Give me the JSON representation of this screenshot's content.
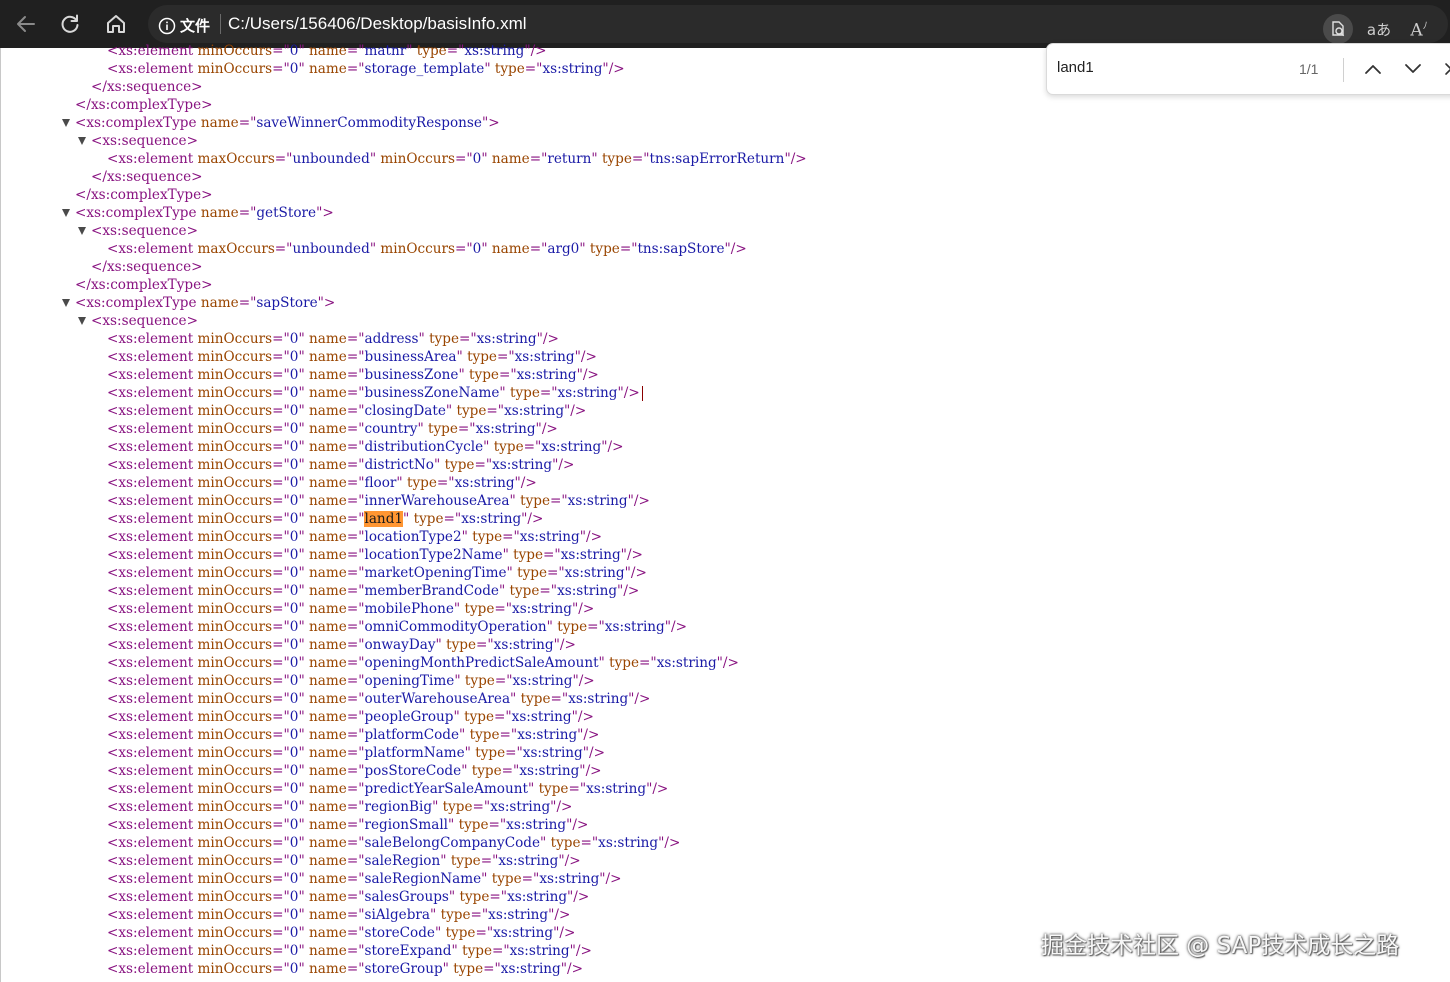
{
  "browser": {
    "info_label": "文件",
    "url": "C:/Users/156406/Desktop/basisInfo.xml"
  },
  "find": {
    "query": "land1",
    "count": "1/1"
  },
  "watermark": "掘金技术社区 @ SAP技术成长之路",
  "xml_lines": [
    {
      "indent": 6,
      "tw": false,
      "kind": "elem",
      "attrs": [
        [
          "minOccurs",
          "0"
        ],
        [
          "name",
          "matnr"
        ],
        [
          "type",
          "xs:string"
        ]
      ]
    },
    {
      "indent": 6,
      "tw": false,
      "kind": "elem",
      "attrs": [
        [
          "minOccurs",
          "0"
        ],
        [
          "name",
          "storage_template"
        ],
        [
          "type",
          "xs:string"
        ]
      ]
    },
    {
      "indent": 4,
      "tw": false,
      "kind": "close",
      "tag": "xs:sequence"
    },
    {
      "indent": 2,
      "tw": false,
      "kind": "close",
      "tag": "xs:complexType"
    },
    {
      "indent": 2,
      "tw": true,
      "kind": "open",
      "tag": "xs:complexType",
      "attrs": [
        [
          "name",
          "saveWinnerCommodityResponse"
        ]
      ]
    },
    {
      "indent": 4,
      "tw": true,
      "kind": "open",
      "tag": "xs:sequence",
      "attrs": []
    },
    {
      "indent": 6,
      "tw": false,
      "kind": "elem",
      "attrs": [
        [
          "maxOccurs",
          "unbounded"
        ],
        [
          "minOccurs",
          "0"
        ],
        [
          "name",
          "return"
        ],
        [
          "type",
          "tns:sapErrorReturn"
        ]
      ]
    },
    {
      "indent": 4,
      "tw": false,
      "kind": "close",
      "tag": "xs:sequence"
    },
    {
      "indent": 2,
      "tw": false,
      "kind": "close",
      "tag": "xs:complexType"
    },
    {
      "indent": 2,
      "tw": true,
      "kind": "open",
      "tag": "xs:complexType",
      "attrs": [
        [
          "name",
          "getStore"
        ]
      ]
    },
    {
      "indent": 4,
      "tw": true,
      "kind": "open",
      "tag": "xs:sequence",
      "attrs": []
    },
    {
      "indent": 6,
      "tw": false,
      "kind": "elem",
      "attrs": [
        [
          "maxOccurs",
          "unbounded"
        ],
        [
          "minOccurs",
          "0"
        ],
        [
          "name",
          "arg0"
        ],
        [
          "type",
          "tns:sapStore"
        ]
      ]
    },
    {
      "indent": 4,
      "tw": false,
      "kind": "close",
      "tag": "xs:sequence"
    },
    {
      "indent": 2,
      "tw": false,
      "kind": "close",
      "tag": "xs:complexType"
    },
    {
      "indent": 2,
      "tw": true,
      "kind": "open",
      "tag": "xs:complexType",
      "attrs": [
        [
          "name",
          "sapStore"
        ]
      ]
    },
    {
      "indent": 4,
      "tw": true,
      "kind": "open",
      "tag": "xs:sequence",
      "attrs": []
    },
    {
      "indent": 6,
      "tw": false,
      "kind": "elem",
      "attrs": [
        [
          "minOccurs",
          "0"
        ],
        [
          "name",
          "address"
        ],
        [
          "type",
          "xs:string"
        ]
      ]
    },
    {
      "indent": 6,
      "tw": false,
      "kind": "elem",
      "attrs": [
        [
          "minOccurs",
          "0"
        ],
        [
          "name",
          "businessArea"
        ],
        [
          "type",
          "xs:string"
        ]
      ]
    },
    {
      "indent": 6,
      "tw": false,
      "kind": "elem",
      "attrs": [
        [
          "minOccurs",
          "0"
        ],
        [
          "name",
          "businessZone"
        ],
        [
          "type",
          "xs:string"
        ]
      ]
    },
    {
      "indent": 6,
      "tw": false,
      "kind": "elem",
      "caret": true,
      "attrs": [
        [
          "minOccurs",
          "0"
        ],
        [
          "name",
          "businessZoneName"
        ],
        [
          "type",
          "xs:string"
        ]
      ]
    },
    {
      "indent": 6,
      "tw": false,
      "kind": "elem",
      "attrs": [
        [
          "minOccurs",
          "0"
        ],
        [
          "name",
          "closingDate"
        ],
        [
          "type",
          "xs:string"
        ]
      ]
    },
    {
      "indent": 6,
      "tw": false,
      "kind": "elem",
      "attrs": [
        [
          "minOccurs",
          "0"
        ],
        [
          "name",
          "country"
        ],
        [
          "type",
          "xs:string"
        ]
      ]
    },
    {
      "indent": 6,
      "tw": false,
      "kind": "elem",
      "attrs": [
        [
          "minOccurs",
          "0"
        ],
        [
          "name",
          "distributionCycle"
        ],
        [
          "type",
          "xs:string"
        ]
      ]
    },
    {
      "indent": 6,
      "tw": false,
      "kind": "elem",
      "attrs": [
        [
          "minOccurs",
          "0"
        ],
        [
          "name",
          "districtNo"
        ],
        [
          "type",
          "xs:string"
        ]
      ]
    },
    {
      "indent": 6,
      "tw": false,
      "kind": "elem",
      "attrs": [
        [
          "minOccurs",
          "0"
        ],
        [
          "name",
          "floor"
        ],
        [
          "type",
          "xs:string"
        ]
      ]
    },
    {
      "indent": 6,
      "tw": false,
      "kind": "elem",
      "attrs": [
        [
          "minOccurs",
          "0"
        ],
        [
          "name",
          "innerWarehouseArea"
        ],
        [
          "type",
          "xs:string"
        ]
      ]
    },
    {
      "indent": 6,
      "tw": false,
      "kind": "elem",
      "highlight": true,
      "attrs": [
        [
          "minOccurs",
          "0"
        ],
        [
          "name",
          "land1"
        ],
        [
          "type",
          "xs:string"
        ]
      ]
    },
    {
      "indent": 6,
      "tw": false,
      "kind": "elem",
      "attrs": [
        [
          "minOccurs",
          "0"
        ],
        [
          "name",
          "locationType2"
        ],
        [
          "type",
          "xs:string"
        ]
      ]
    },
    {
      "indent": 6,
      "tw": false,
      "kind": "elem",
      "attrs": [
        [
          "minOccurs",
          "0"
        ],
        [
          "name",
          "locationType2Name"
        ],
        [
          "type",
          "xs:string"
        ]
      ]
    },
    {
      "indent": 6,
      "tw": false,
      "kind": "elem",
      "attrs": [
        [
          "minOccurs",
          "0"
        ],
        [
          "name",
          "marketOpeningTime"
        ],
        [
          "type",
          "xs:string"
        ]
      ]
    },
    {
      "indent": 6,
      "tw": false,
      "kind": "elem",
      "attrs": [
        [
          "minOccurs",
          "0"
        ],
        [
          "name",
          "memberBrandCode"
        ],
        [
          "type",
          "xs:string"
        ]
      ]
    },
    {
      "indent": 6,
      "tw": false,
      "kind": "elem",
      "attrs": [
        [
          "minOccurs",
          "0"
        ],
        [
          "name",
          "mobilePhone"
        ],
        [
          "type",
          "xs:string"
        ]
      ]
    },
    {
      "indent": 6,
      "tw": false,
      "kind": "elem",
      "attrs": [
        [
          "minOccurs",
          "0"
        ],
        [
          "name",
          "omniCommodityOperation"
        ],
        [
          "type",
          "xs:string"
        ]
      ]
    },
    {
      "indent": 6,
      "tw": false,
      "kind": "elem",
      "attrs": [
        [
          "minOccurs",
          "0"
        ],
        [
          "name",
          "onwayDay"
        ],
        [
          "type",
          "xs:string"
        ]
      ]
    },
    {
      "indent": 6,
      "tw": false,
      "kind": "elem",
      "attrs": [
        [
          "minOccurs",
          "0"
        ],
        [
          "name",
          "openingMonthPredictSaleAmount"
        ],
        [
          "type",
          "xs:string"
        ]
      ]
    },
    {
      "indent": 6,
      "tw": false,
      "kind": "elem",
      "attrs": [
        [
          "minOccurs",
          "0"
        ],
        [
          "name",
          "openingTime"
        ],
        [
          "type",
          "xs:string"
        ]
      ]
    },
    {
      "indent": 6,
      "tw": false,
      "kind": "elem",
      "attrs": [
        [
          "minOccurs",
          "0"
        ],
        [
          "name",
          "outerWarehouseArea"
        ],
        [
          "type",
          "xs:string"
        ]
      ]
    },
    {
      "indent": 6,
      "tw": false,
      "kind": "elem",
      "attrs": [
        [
          "minOccurs",
          "0"
        ],
        [
          "name",
          "peopleGroup"
        ],
        [
          "type",
          "xs:string"
        ]
      ]
    },
    {
      "indent": 6,
      "tw": false,
      "kind": "elem",
      "attrs": [
        [
          "minOccurs",
          "0"
        ],
        [
          "name",
          "platformCode"
        ],
        [
          "type",
          "xs:string"
        ]
      ]
    },
    {
      "indent": 6,
      "tw": false,
      "kind": "elem",
      "attrs": [
        [
          "minOccurs",
          "0"
        ],
        [
          "name",
          "platformName"
        ],
        [
          "type",
          "xs:string"
        ]
      ]
    },
    {
      "indent": 6,
      "tw": false,
      "kind": "elem",
      "attrs": [
        [
          "minOccurs",
          "0"
        ],
        [
          "name",
          "posStoreCode"
        ],
        [
          "type",
          "xs:string"
        ]
      ]
    },
    {
      "indent": 6,
      "tw": false,
      "kind": "elem",
      "attrs": [
        [
          "minOccurs",
          "0"
        ],
        [
          "name",
          "predictYearSaleAmount"
        ],
        [
          "type",
          "xs:string"
        ]
      ]
    },
    {
      "indent": 6,
      "tw": false,
      "kind": "elem",
      "attrs": [
        [
          "minOccurs",
          "0"
        ],
        [
          "name",
          "regionBig"
        ],
        [
          "type",
          "xs:string"
        ]
      ]
    },
    {
      "indent": 6,
      "tw": false,
      "kind": "elem",
      "attrs": [
        [
          "minOccurs",
          "0"
        ],
        [
          "name",
          "regionSmall"
        ],
        [
          "type",
          "xs:string"
        ]
      ]
    },
    {
      "indent": 6,
      "tw": false,
      "kind": "elem",
      "attrs": [
        [
          "minOccurs",
          "0"
        ],
        [
          "name",
          "saleBelongCompanyCode"
        ],
        [
          "type",
          "xs:string"
        ]
      ]
    },
    {
      "indent": 6,
      "tw": false,
      "kind": "elem",
      "attrs": [
        [
          "minOccurs",
          "0"
        ],
        [
          "name",
          "saleRegion"
        ],
        [
          "type",
          "xs:string"
        ]
      ]
    },
    {
      "indent": 6,
      "tw": false,
      "kind": "elem",
      "attrs": [
        [
          "minOccurs",
          "0"
        ],
        [
          "name",
          "saleRegionName"
        ],
        [
          "type",
          "xs:string"
        ]
      ]
    },
    {
      "indent": 6,
      "tw": false,
      "kind": "elem",
      "attrs": [
        [
          "minOccurs",
          "0"
        ],
        [
          "name",
          "salesGroups"
        ],
        [
          "type",
          "xs:string"
        ]
      ]
    },
    {
      "indent": 6,
      "tw": false,
      "kind": "elem",
      "attrs": [
        [
          "minOccurs",
          "0"
        ],
        [
          "name",
          "siAlgebra"
        ],
        [
          "type",
          "xs:string"
        ]
      ]
    },
    {
      "indent": 6,
      "tw": false,
      "kind": "elem",
      "attrs": [
        [
          "minOccurs",
          "0"
        ],
        [
          "name",
          "storeCode"
        ],
        [
          "type",
          "xs:string"
        ]
      ]
    },
    {
      "indent": 6,
      "tw": false,
      "kind": "elem",
      "attrs": [
        [
          "minOccurs",
          "0"
        ],
        [
          "name",
          "storeExpand"
        ],
        [
          "type",
          "xs:string"
        ]
      ]
    },
    {
      "indent": 6,
      "tw": false,
      "kind": "elem",
      "attrs": [
        [
          "minOccurs",
          "0"
        ],
        [
          "name",
          "storeGroup"
        ],
        [
          "type",
          "xs:string"
        ]
      ]
    }
  ]
}
